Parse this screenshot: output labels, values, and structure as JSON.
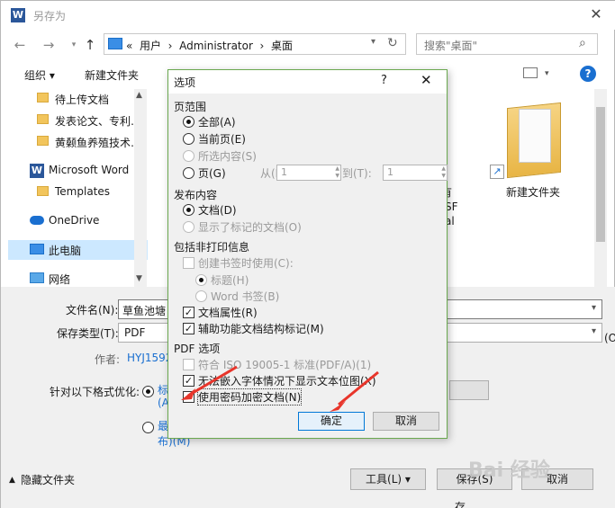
{
  "window": {
    "title": "另存为"
  },
  "nav": {
    "breadcrumb": [
      "«",
      "用户",
      "›",
      "Administrator",
      "›",
      "桌面"
    ],
    "search_placeholder": "搜索\"桌面\""
  },
  "toolbar": {
    "organize": "组织 ▾",
    "new_folder": "新建文件夹"
  },
  "sidebar": {
    "items": [
      {
        "label": "待上传文档"
      },
      {
        "label": "发表论文、专利…"
      },
      {
        "label": "黄颡鱼养殖技术…"
      },
      {
        "label": "Microsoft Word"
      },
      {
        "label": "Templates"
      },
      {
        "label": "OneDrive"
      },
      {
        "label": "此电脑"
      },
      {
        "label": "网络"
      }
    ]
  },
  "files": {
    "new_folder_label": "新建文件夹",
    "partial_labels": [
      "有",
      "SF",
      "al"
    ]
  },
  "form": {
    "filename_label": "文件名(N):",
    "filename_value": "草鱼池塘",
    "filetype_label": "保存类型(T):",
    "filetype_value": "PDF",
    "author_label": "作者:",
    "author_value": "HYJ1592",
    "optimize_label": "针对以下格式优化:",
    "opt1_a": "标",
    "opt1_b": "(A",
    "opt2_a": "最",
    "opt2_b": "布)(M)",
    "tools_button": "工具(L) ▾",
    "save_button": "保存(S)",
    "cancel_button": "取消",
    "hide_folders": "隐藏文件夹",
    "partial_right": "(O",
    "partial_right2": "存"
  },
  "dialog": {
    "title": "选项",
    "help": "?",
    "close": "✕",
    "page_range_heading": "页范围",
    "range_all": "全部(A)",
    "range_current": "当前页(E)",
    "range_selection": "所选内容(S)",
    "range_pages": "页(G)",
    "from_label": "从(F):",
    "from_value": "1",
    "to_label": "到(T):",
    "to_value": "1",
    "publish_heading": "发布内容",
    "publish_doc": "文档(D)",
    "publish_markup": "显示了标记的文档(O)",
    "nonprint_heading": "包括非打印信息",
    "bookmarks": "创建书签时使用(C):",
    "bm_headings": "标题(H)",
    "bm_word": "Word 书签(B)",
    "doc_properties": "文档属性(R)",
    "structure_tags": "辅助功能文档结构标记(M)",
    "pdf_heading": "PDF 选项",
    "iso": "符合 ISO 19005-1 标准(PDF/A)(1)",
    "bitmap_text": "无法嵌入字体情况下显示文本位图(X)",
    "encrypt": "使用密码加密文档(N)",
    "ok_button": "确定",
    "cancel_button": "取消"
  },
  "watermark": "Bai 经验",
  "colors": {
    "accent": "#1a6fd0",
    "annotation_arrow": "#e8352b",
    "dialog_border": "#6aa84f"
  }
}
